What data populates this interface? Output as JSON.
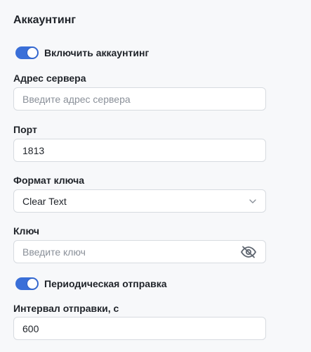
{
  "section": {
    "title": "Аккаунтинг"
  },
  "accounting_toggle": {
    "label": "Включить аккаунтинг",
    "enabled": true
  },
  "server_address": {
    "label": "Адрес сервера",
    "value": "",
    "placeholder": "Введите адрес сервера"
  },
  "port": {
    "label": "Порт",
    "value": "1813"
  },
  "key_format": {
    "label": "Формат ключа",
    "selected": "Clear Text",
    "icon": "chevron-down-icon"
  },
  "key": {
    "label": "Ключ",
    "value": "",
    "placeholder": "Введите ключ",
    "icon": "eye-off-icon"
  },
  "periodic_toggle": {
    "label": "Периодическая отправка",
    "enabled": true
  },
  "send_interval": {
    "label": "Интервал отправки, с",
    "value": "600"
  },
  "colors": {
    "accent": "#3a6fd8",
    "background": "#f7f8fa",
    "border": "#d7dbe0",
    "placeholder": "#8a9099"
  }
}
